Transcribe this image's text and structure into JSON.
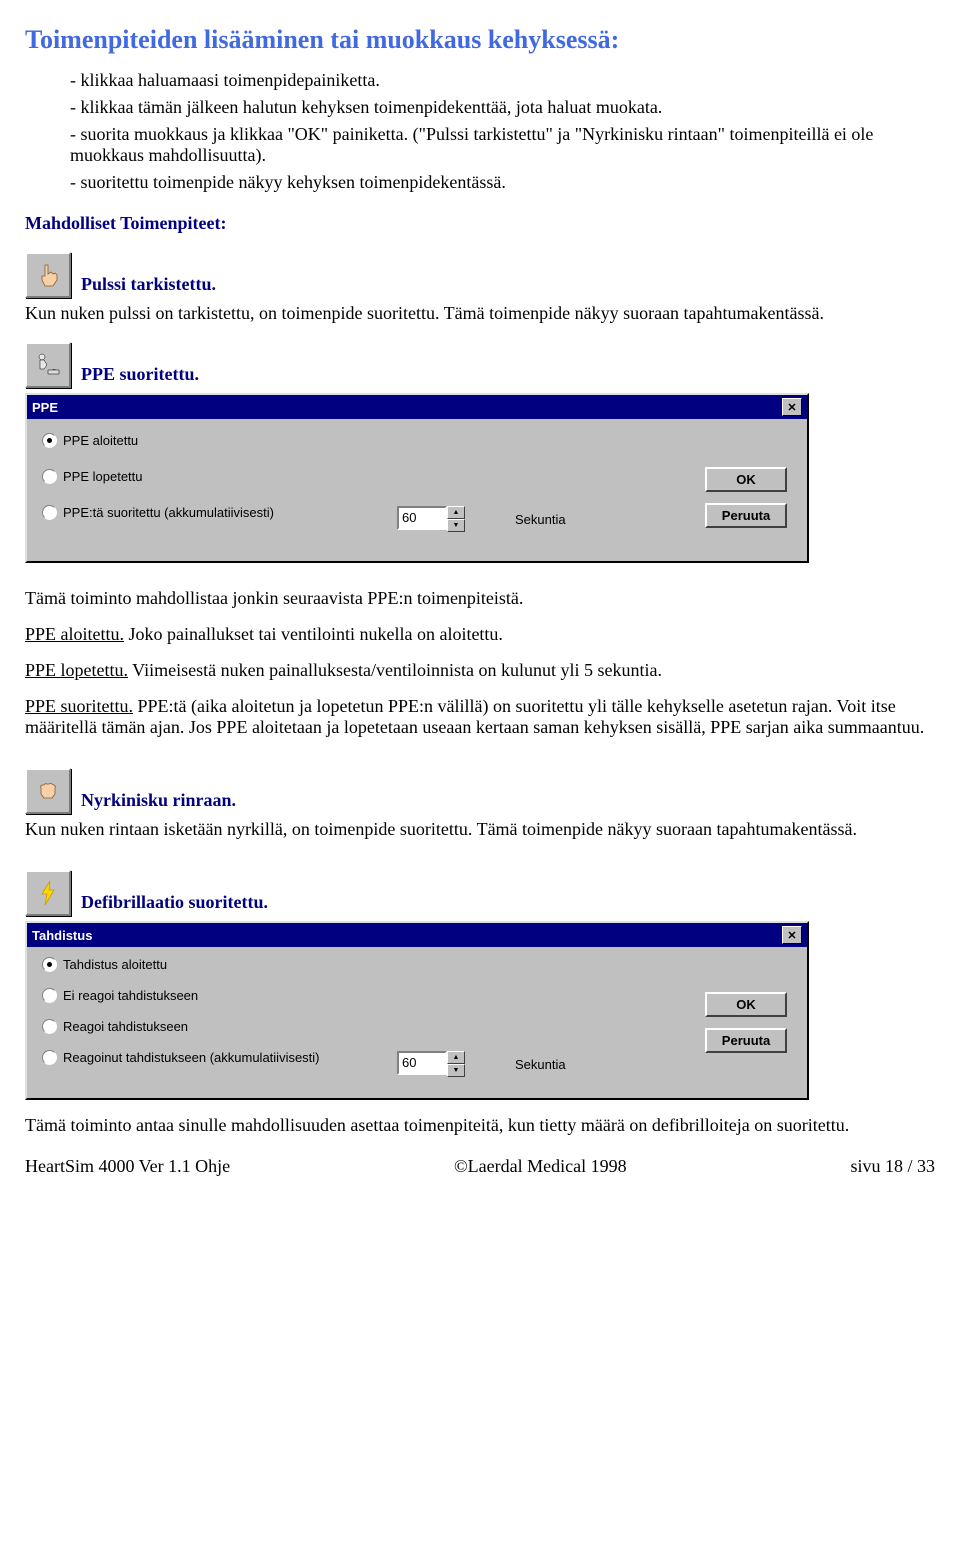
{
  "heading": "Toimenpiteiden lisääminen tai muokkaus kehyksessä:",
  "steps": {
    "s1": "- klikkaa haluamaasi toimenpidepainiketta.",
    "s2": "- klikkaa tämän jälkeen halutun kehyksen toimenpidekenttää, jota haluat muokata.",
    "s3": "- suorita muokkaus ja klikkaa \"OK\" painiketta. (\"Pulssi tarkistettu\" ja \"Nyrkinisku rintaan\" toimenpiteillä ei ole muokkaus mahdollisuutta).",
    "s4": "- suoritettu toimenpide näkyy kehyksen toimenpidekentässä."
  },
  "section_label": "Mahdolliset Toimenpiteet:",
  "pulssi": {
    "title": "Pulssi tarkistettu.",
    "body": "Kun nuken pulssi on tarkistettu, on toimenpide suoritettu. Tämä toimenpide näkyy suoraan tapahtumakentässä."
  },
  "ppe": {
    "title": "PPE suoritettu.",
    "dialog_title": "PPE",
    "opt1": "PPE aloitettu",
    "opt2": "PPE lopetettu",
    "opt3": "PPE:tä suoritettu (akkumulatiivisesti)",
    "spinner": "60",
    "sekuntia": "Sekuntia",
    "ok": "OK",
    "cancel": "Peruuta",
    "desc": "Tämä toiminto mahdollistaa jonkin seuraavista PPE:n toimenpiteistä.",
    "line1_u": "PPE aloitettu.",
    "line1": " Joko painallukset tai ventilointi nukella on aloitettu.",
    "line2_u": "PPE lopetettu.",
    "line2": " Viimeisestä nuken painalluksesta/ventiloinnista on kulunut yli 5 sekuntia.",
    "line3_u": "PPE suoritettu.",
    "line3": " PPE:tä (aika aloitetun ja lopetetun PPE:n välillä) on suoritettu yli tälle kehykselle asetetun rajan. Voit itse määritellä tämän ajan. Jos PPE aloitetaan ja lopetetaan useaan kertaan saman kehyksen sisällä, PPE sarjan aika summaantuu."
  },
  "nyrkki": {
    "title": "Nyrkinisku rinraan.",
    "body": "Kun nuken rintaan isketään nyrkillä, on toimenpide suoritettu. Tämä toimenpide näkyy suoraan tapahtumakentässä."
  },
  "defib": {
    "title": "Defibrillaatio suoritettu.",
    "dialog_title": "Tahdistus",
    "opt1": "Tahdistus aloitettu",
    "opt2": "Ei reagoi tahdistukseen",
    "opt3": "Reagoi tahdistukseen",
    "opt4": "Reagoinut tahdistukseen (akkumulatiivisesti)",
    "spinner": "60",
    "sekuntia": "Sekuntia",
    "ok": "OK",
    "cancel": "Peruuta",
    "desc": "Tämä toiminto antaa sinulle mahdollisuuden asettaa toimenpiteitä, kun tietty määrä on defibrilloiteja on suoritettu."
  },
  "footer": {
    "left": "HeartSim 4000 Ver 1.1 Ohje",
    "center": "©Laerdal Medical 1998",
    "right": "sivu 18 / 33"
  }
}
